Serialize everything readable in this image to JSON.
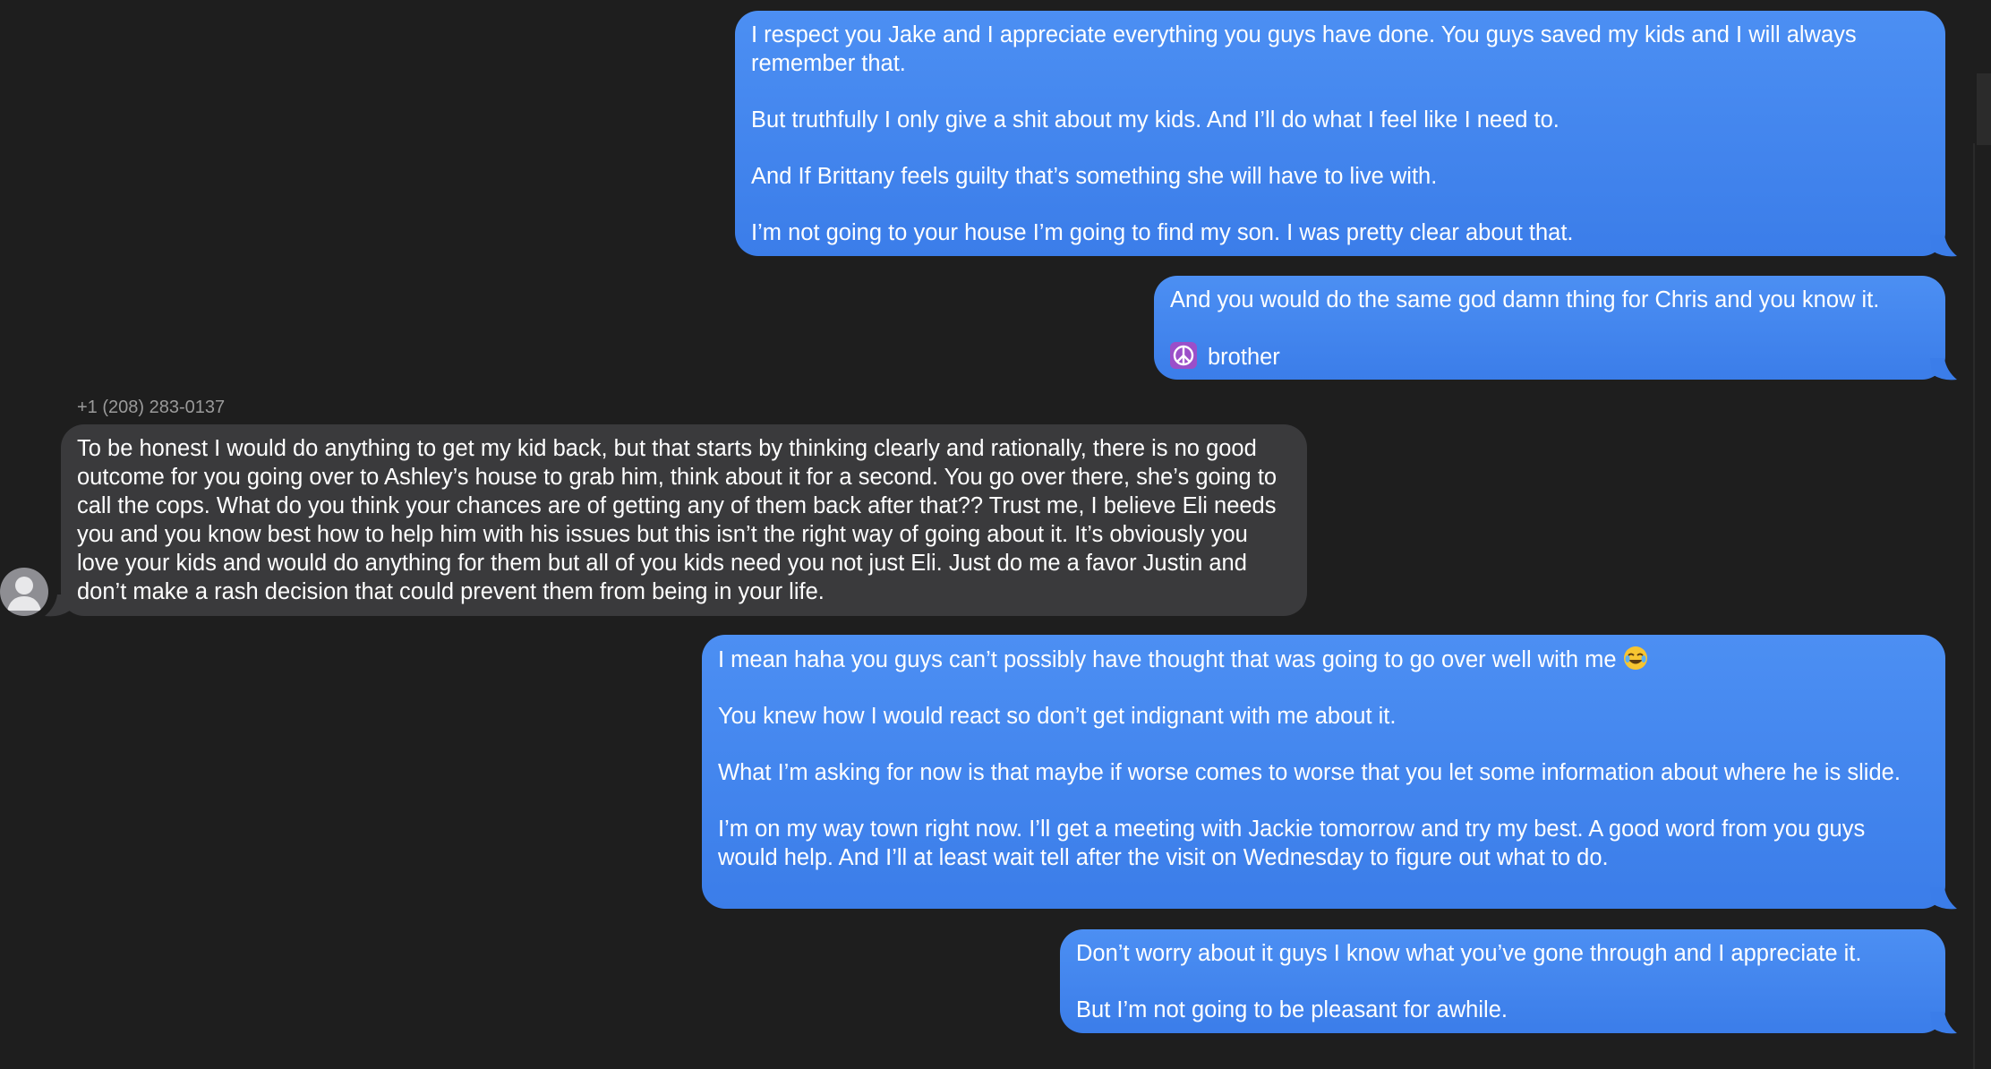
{
  "conversation": {
    "messages": [
      {
        "direction": "outgoing",
        "paragraphs": [
          "I respect you Jake and I appreciate everything you guys have done. You guys saved my kids and I will always remember that.",
          "But truthfully I only give a shit about my kids. And I’ll do what I feel like I need to.",
          "And If Brittany feels guilty that’s something she will have to live with.",
          "I’m not going to your house I’m going to find my son. I was pretty clear about that."
        ]
      },
      {
        "direction": "outgoing",
        "paragraphs": [
          "And you would do the same god damn thing for Chris and you know it.",
          "brother"
        ],
        "emoji": "peace-symbol-icon"
      },
      {
        "direction": "incoming",
        "sender": "+1 (208) 283-0137",
        "paragraphs": [
          "To be honest I would do anything to get my kid back, but that starts by thinking clearly and rationally, there is no good outcome for you going over to Ashley’s house to grab him, think about it for a second. You go over there, she’s going to call the cops. What do you think your chances are of getting any of them back after that?? Trust me, I believe Eli needs you and you know best how to help him with his issues but this isn’t the right way of going about it. It’s obviously you love your kids and would do anything for them but all of you kids need you not just Eli. Just do me a favor Justin and don’t make a rash decision that could prevent them from being in your life."
        ]
      },
      {
        "direction": "outgoing",
        "paragraphs": [
          "I mean haha you guys can’t possibly have thought that was going to go over well with me",
          "You knew how I would react so don’t get indignant with me about it.",
          "What I’m asking for now is that maybe if worse comes to worse that you let some information about where he is slide.",
          "I’m on my way town right now. I’ll get a meeting with Jackie tomorrow and try my best. A good word from you guys would help. And I’ll at least wait tell after the visit on Wednesday to figure out what to do."
        ],
        "emoji": "face-with-tears-of-joy-icon"
      },
      {
        "direction": "outgoing",
        "paragraphs": [
          "Don’t worry about it guys I know what you’ve gone through and I appreciate it.",
          "But I’m not going to be pleasant for awhile."
        ]
      }
    ]
  },
  "colors": {
    "background": "#1e1e1e",
    "outgoing_bubble": "#3b82f0",
    "incoming_bubble": "#3a3a3c",
    "sender_label": "#9a9a9a"
  }
}
